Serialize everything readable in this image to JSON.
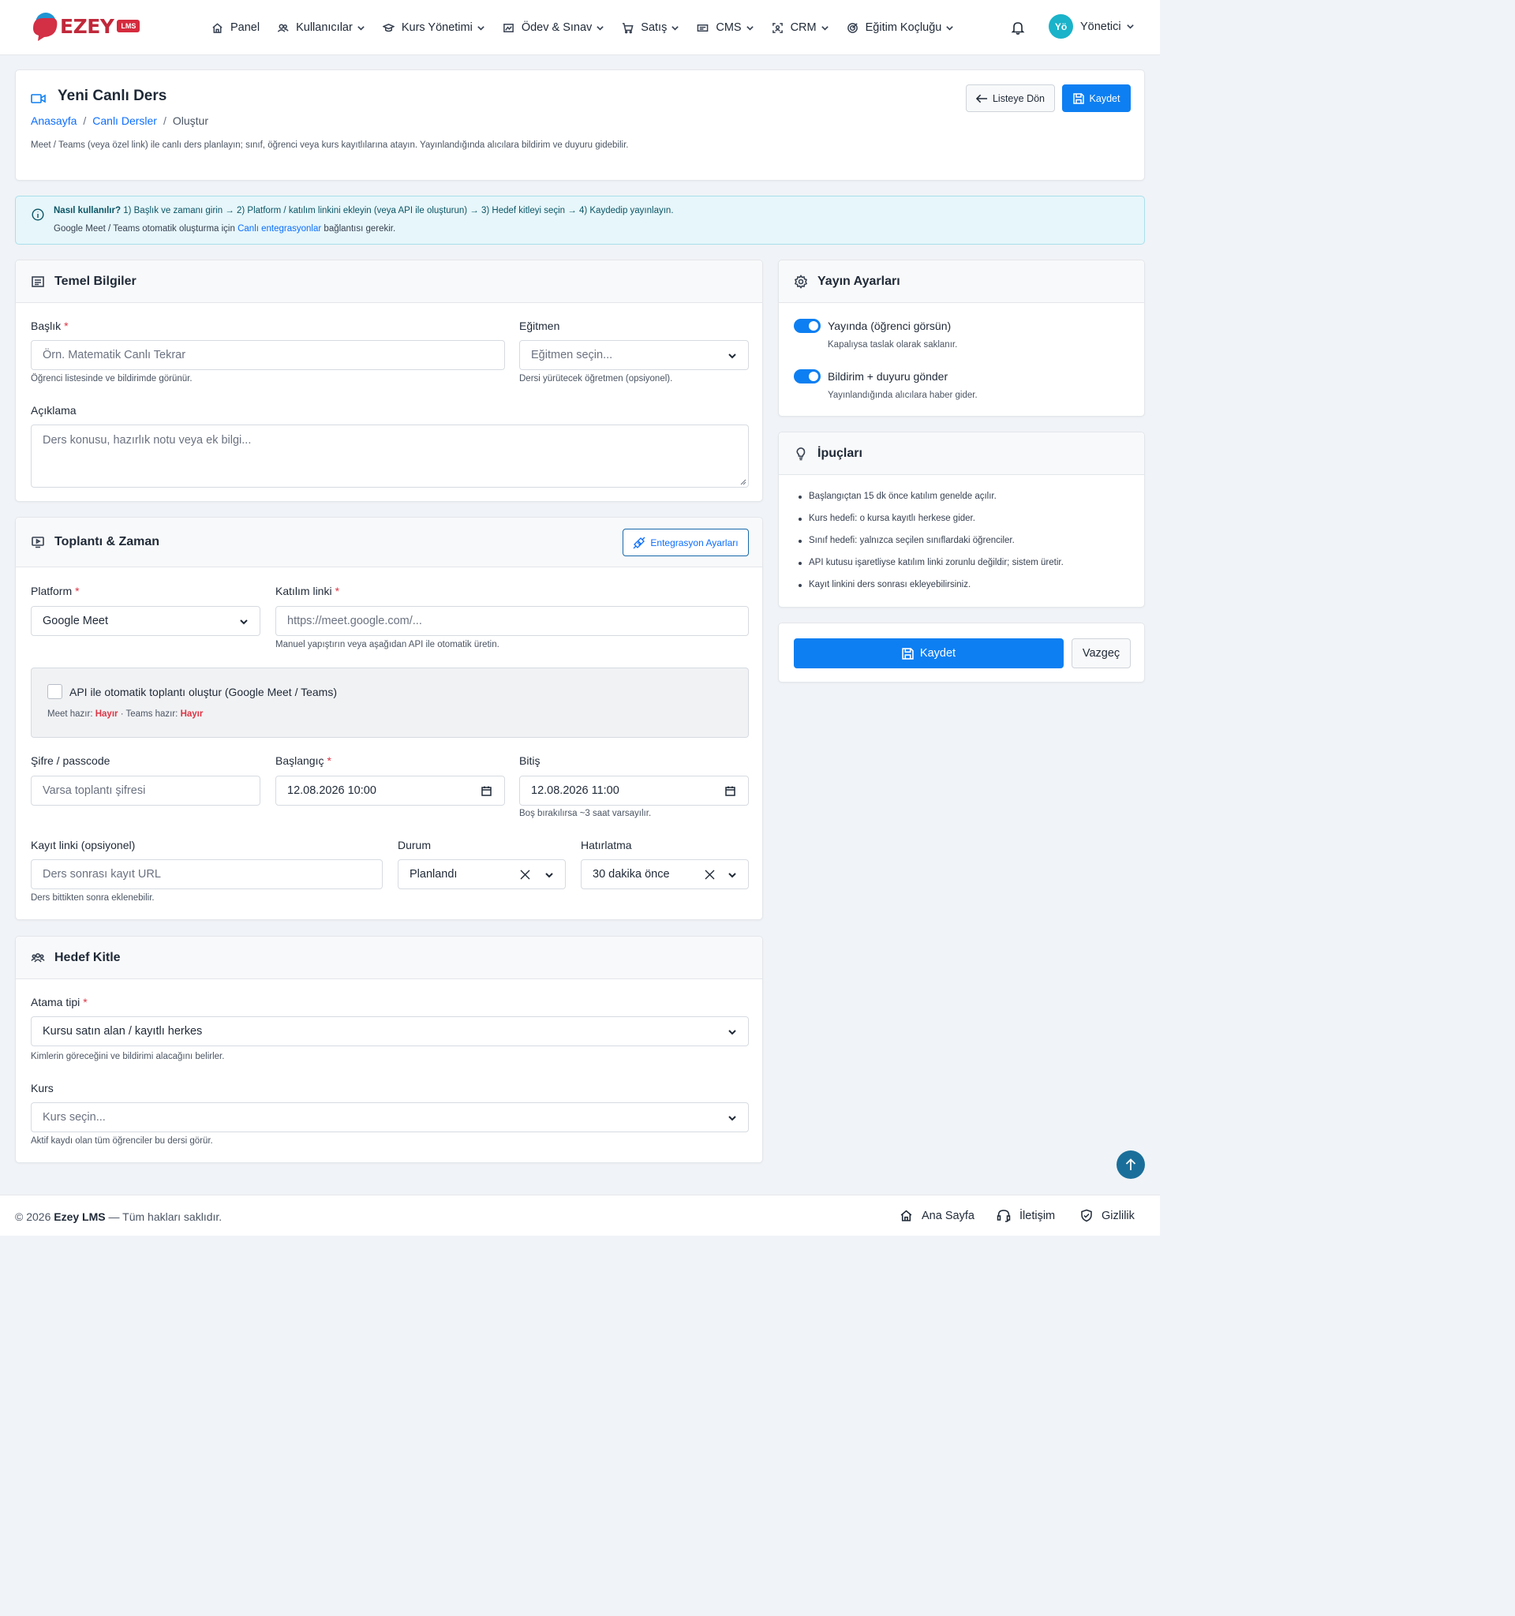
{
  "brand": {
    "name": "EZEY",
    "badge": "LMS"
  },
  "nav": {
    "items": [
      {
        "label": "Panel",
        "icon": "home-icon"
      },
      {
        "label": "Kullanıcılar",
        "icon": "users-icon"
      },
      {
        "label": "Kurs Yönetimi",
        "icon": "graduation-cap-icon"
      },
      {
        "label": "Ödev & Sınav",
        "icon": "assignment-icon"
      },
      {
        "label": "Satış",
        "icon": "cart-icon"
      },
      {
        "label": "CMS",
        "icon": "cms-icon"
      },
      {
        "label": "CRM",
        "icon": "crm-icon"
      },
      {
        "label": "Eğitim Koçluğu",
        "icon": "target-icon"
      }
    ],
    "user_initials": "Yö",
    "user_name": "Yönetici"
  },
  "page": {
    "title": "Yeni Canlı Ders",
    "breadcrumb": [
      "Anasayfa",
      "Canlı Dersler",
      "Oluştur"
    ],
    "description": "Meet / Teams (veya özel link) ile canlı ders planlayın; sınıf, öğrenci veya kurs kayıtlılarına atayın. Yayınlandığında alıcılara bildirim ve duyuru gidebilir.",
    "back_label": "Listeye Dön",
    "save_label": "Kaydet"
  },
  "info": {
    "prefix": "Nasıl kullanılır?",
    "steps": "1) Başlık ve zamanı girin → 2) Platform / katılım linkini ekleyin (veya API ile oluşturun) → 3) Hedef kitleyi seçin → 4) Kaydedip yayınlayın.",
    "line2_a": "Google Meet / Teams otomatik oluşturma için",
    "line2_link": "Canlı entegrasyonlar",
    "line2_b": "bağlantısı gerekir."
  },
  "basic": {
    "title": "Temel Bilgiler",
    "title_label": "Başlık",
    "title_placeholder": "Örn. Matematik Canlı Tekrar",
    "title_help": "Öğrenci listesinde ve bildirimde görünür.",
    "instructor_label": "Eğitmen",
    "instructor_placeholder": "Eğitmen seçin...",
    "instructor_help": "Dersi yürütecek öğretmen (opsiyonel).",
    "desc_label": "Açıklama",
    "desc_placeholder": "Ders konusu, hazırlık notu veya ek bilgi..."
  },
  "meeting": {
    "title": "Toplantı & Zaman",
    "integration_button": "Entegrasyon Ayarları",
    "platform_label": "Platform",
    "platform_value": "Google Meet",
    "link_label": "Katılım linki",
    "link_placeholder": "https://meet.google.com/...",
    "link_help": "Manuel yapıştırın veya aşağıdan API ile otomatik üretin.",
    "api_label": "API ile otomatik toplantı oluştur (Google Meet / Teams)",
    "meet_ready_label": "Meet hazır:",
    "meet_ready_value": "Hayır",
    "teams_ready_label": "· Teams hazır:",
    "teams_ready_value": "Hayır",
    "passcode_label": "Şifre / passcode",
    "passcode_placeholder": "Varsa toplantı şifresi",
    "start_label": "Başlangıç",
    "start_value": "12.08.2026 10:00",
    "end_label": "Bitiş",
    "end_value": "12.08.2026 11:00",
    "end_help": "Boş bırakılırsa ~3 saat varsayılır.",
    "record_label": "Kayıt linki (opsiyonel)",
    "record_placeholder": "Ders sonrası kayıt URL",
    "record_help": "Ders bittikten sonra eklenebilir.",
    "status_label": "Durum",
    "status_value": "Planlandı",
    "reminder_label": "Hatırlatma",
    "reminder_value": "30 dakika önce"
  },
  "audience": {
    "title": "Hedef Kitle",
    "type_label": "Atama tipi",
    "type_value": "Kursu satın alan / kayıtlı herkes",
    "type_help": "Kimlerin göreceğini ve bildirimi alacağını belirler.",
    "course_label": "Kurs",
    "course_placeholder": "Kurs seçin...",
    "course_help": "Aktif kaydı olan tüm öğrenciler bu dersi görür."
  },
  "publish": {
    "title": "Yayın Ayarları",
    "publish_label": "Yayında (öğrenci görsün)",
    "publish_help": "Kapalıysa taslak olarak saklanır.",
    "publish_on": true,
    "notify_label": "Bildirim + duyuru gönder",
    "notify_help": "Yayınlandığında alıcılara haber gider.",
    "notify_on": true
  },
  "tips": {
    "title": "İpuçları",
    "items": [
      "Başlangıçtan 15 dk önce katılım genelde açılır.",
      "Kurs hedefi: o kursa kayıtlı herkese gider.",
      "Sınıf hedefi: yalnızca seçilen sınıflardaki öğrenciler.",
      "API kutusu işaretliyse katılım linki zorunlu değildir; sistem üretir.",
      "Kayıt linkini ders sonrası ekleyebilirsiniz."
    ]
  },
  "actions": {
    "save": "Kaydet",
    "cancel": "Vazgeç"
  },
  "footer": {
    "copyright": "© 2026",
    "brand": "Ezey LMS",
    "rights": "— Tüm hakları saklıdır.",
    "links": [
      "Ana Sayfa",
      "İletişim",
      "Gizlilik"
    ]
  },
  "colors": {
    "primary": "#0d7ff2",
    "danger": "#dc3545",
    "info_bg": "#e6f6fa",
    "avatar": "#1ab3c9"
  }
}
